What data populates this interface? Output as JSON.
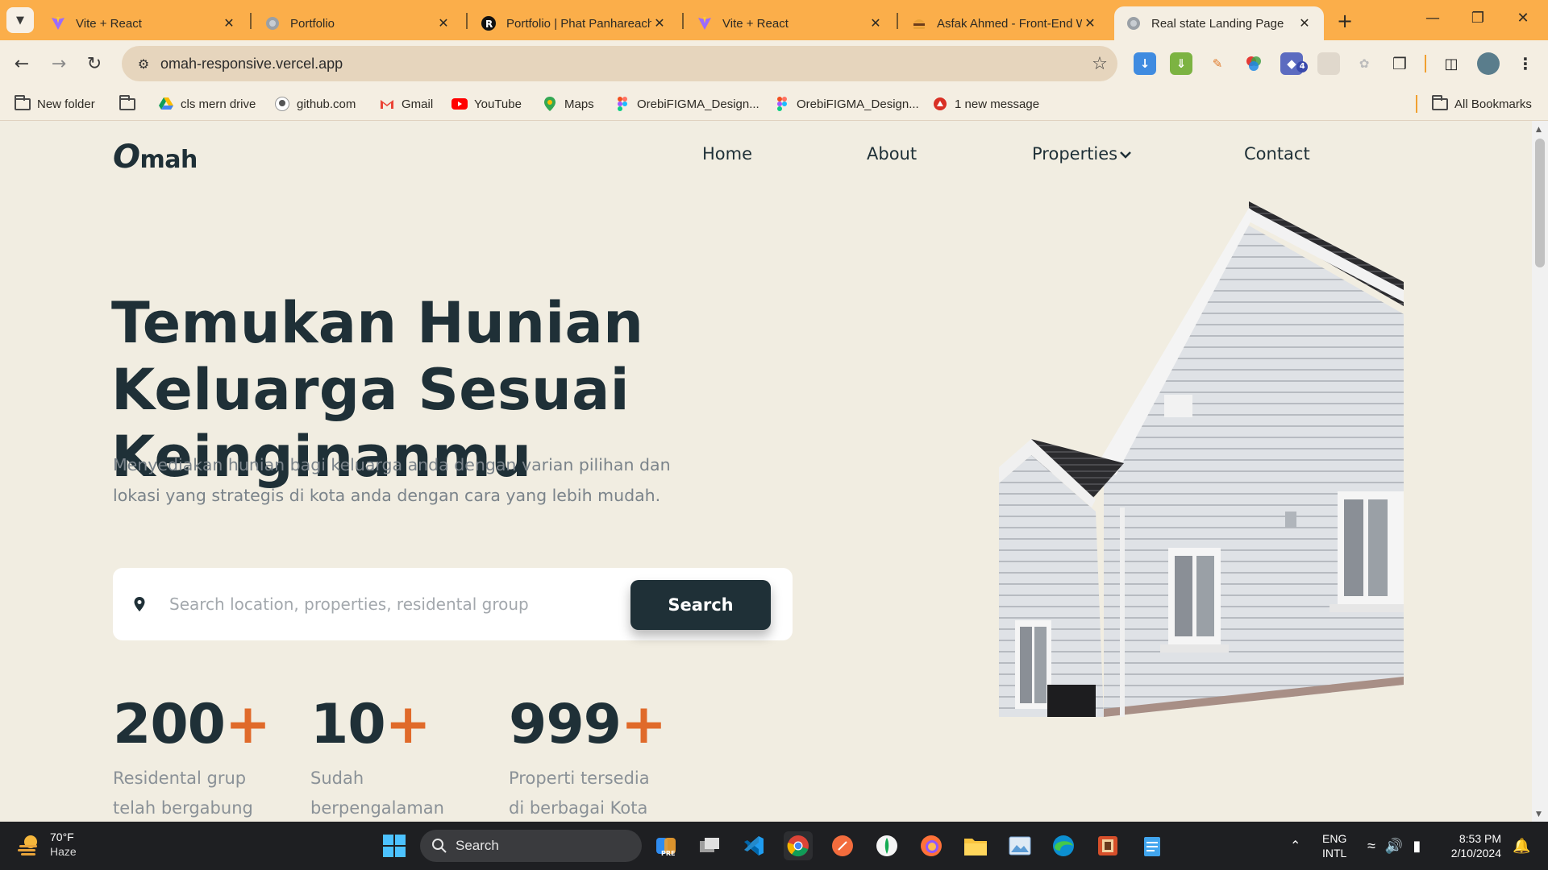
{
  "browser": {
    "tabs": [
      {
        "title": "Vite + React",
        "icon": "vite-icon",
        "active": false
      },
      {
        "title": "Portfolio",
        "icon": "globe-icon",
        "active": false
      },
      {
        "title": "Portfolio | Phat Panhareach",
        "icon": "r-logo-icon",
        "active": false
      },
      {
        "title": "Vite + React",
        "icon": "vite-icon",
        "active": false
      },
      {
        "title": "Asfak Ahmed - Front-End W",
        "icon": "burger-icon",
        "active": false
      },
      {
        "title": "Real state Landing Page",
        "icon": "globe-icon",
        "active": true
      }
    ],
    "url": "omah-responsive.vercel.app",
    "extension_badge": "4",
    "bookmarks": [
      {
        "label": "New folder",
        "icon": "folder-icon"
      },
      {
        "label": "",
        "icon": "folder-icon"
      },
      {
        "label": "cls mern drive",
        "icon": "google-drive-icon"
      },
      {
        "label": "github.com",
        "icon": "github-icon"
      },
      {
        "label": "Gmail",
        "icon": "gmail-icon"
      },
      {
        "label": "YouTube",
        "icon": "youtube-icon"
      },
      {
        "label": "Maps",
        "icon": "maps-icon"
      },
      {
        "label": "OrebiFIGMA_Design...",
        "icon": "figma-icon"
      },
      {
        "label": "OrebiFIGMA_Design...",
        "icon": "figma-icon"
      },
      {
        "label": "1 new message",
        "icon": "message-icon"
      }
    ],
    "all_bookmarks": "All Bookmarks"
  },
  "site": {
    "logo_o": "O",
    "logo_rest": "mah",
    "nav": [
      "Home",
      "About",
      "Properties",
      "Contact"
    ],
    "hero_title": "Temukan Hunian Keluarga Sesuai Keinginanmu",
    "hero_subtitle": "Menyediakan hunian bagi keluarga anda dengan varian pilihan dan lokasi yang strategis di kota anda dengan cara yang lebih mudah.",
    "search_placeholder": "Search location, properties, residental group",
    "search_button": "Search",
    "stats": [
      {
        "value": "200",
        "suffix": "+",
        "label": "Residental grup telah bergabung"
      },
      {
        "value": "10",
        "suffix": "+",
        "label": "Sudah berpengalaman"
      },
      {
        "value": "999",
        "suffix": "+",
        "label": "Properti tersedia di berbagai Kota"
      }
    ],
    "colors": {
      "primary": "#1f3037",
      "accent": "#e06a2a",
      "background": "#f1ede1"
    }
  },
  "taskbar": {
    "weather_temp": "70°F",
    "weather_cond": "Haze",
    "search_label": "Search",
    "lang_1": "ENG",
    "lang_2": "INTL",
    "time": "8:53 PM",
    "date": "2/10/2024"
  }
}
